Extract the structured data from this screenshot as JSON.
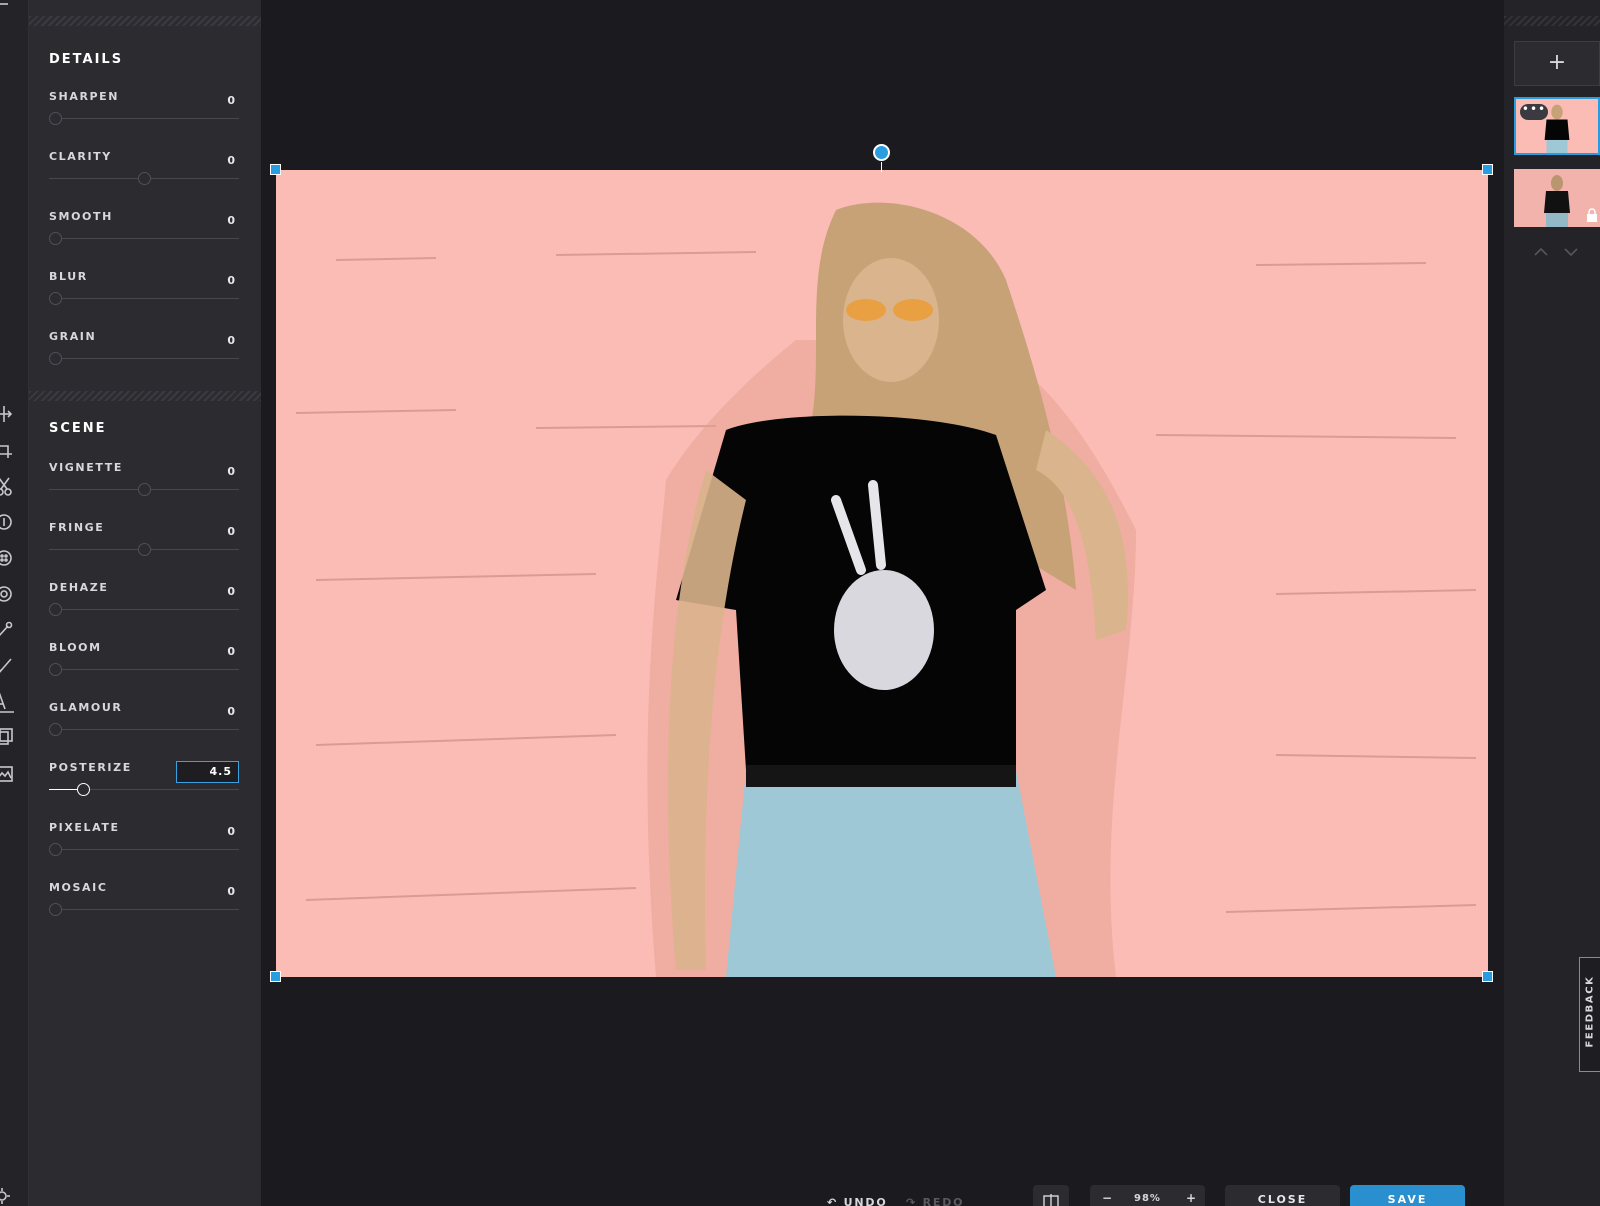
{
  "details": {
    "title": "DETAILS",
    "controls": [
      {
        "label": "SHARPEN",
        "value": "0",
        "level": 0
      },
      {
        "label": "CLARITY",
        "value": "0",
        "level": 0.5
      },
      {
        "label": "SMOOTH",
        "value": "0",
        "level": 0
      },
      {
        "label": "BLUR",
        "value": "0",
        "level": 0
      },
      {
        "label": "GRAIN",
        "value": "0",
        "level": 0
      }
    ]
  },
  "scene": {
    "title": "SCENE",
    "controls": [
      {
        "label": "VIGNETTE",
        "value": "0",
        "level": 0.5
      },
      {
        "label": "FRINGE",
        "value": "0",
        "level": 0.5
      },
      {
        "label": "DEHAZE",
        "value": "0",
        "level": 0
      },
      {
        "label": "BLOOM",
        "value": "0",
        "level": 0
      },
      {
        "label": "GLAMOUR",
        "value": "0",
        "level": 0
      },
      {
        "label": "POSTERIZE",
        "value": "4.5",
        "level": 0.16,
        "active": true
      },
      {
        "label": "PIXELATE",
        "value": "0",
        "level": 0
      },
      {
        "label": "MOSAIC",
        "value": "0",
        "level": 0
      }
    ]
  },
  "layers": {
    "add_label": "+",
    "menu_label": "•••"
  },
  "toolbar": {
    "undo_label": "UNDO",
    "redo_label": "REDO",
    "zoom_minus": "−",
    "zoom_value": "98%",
    "zoom_plus": "+",
    "close_label": "CLOSE",
    "save_label": "SAVE"
  },
  "feedback_label": "FEEDBACK",
  "colors": {
    "accent": "#2a8fce",
    "photo_background": "#fbbcb6",
    "panel": "#2b2b30"
  },
  "icons": [
    "move-icon",
    "crop-icon",
    "cut-icon",
    "adjust-icon",
    "filter-icon",
    "vignette-icon",
    "dropper-icon",
    "brush-icon",
    "text-icon",
    "overlay-icon",
    "image-icon",
    "settings-icon"
  ]
}
